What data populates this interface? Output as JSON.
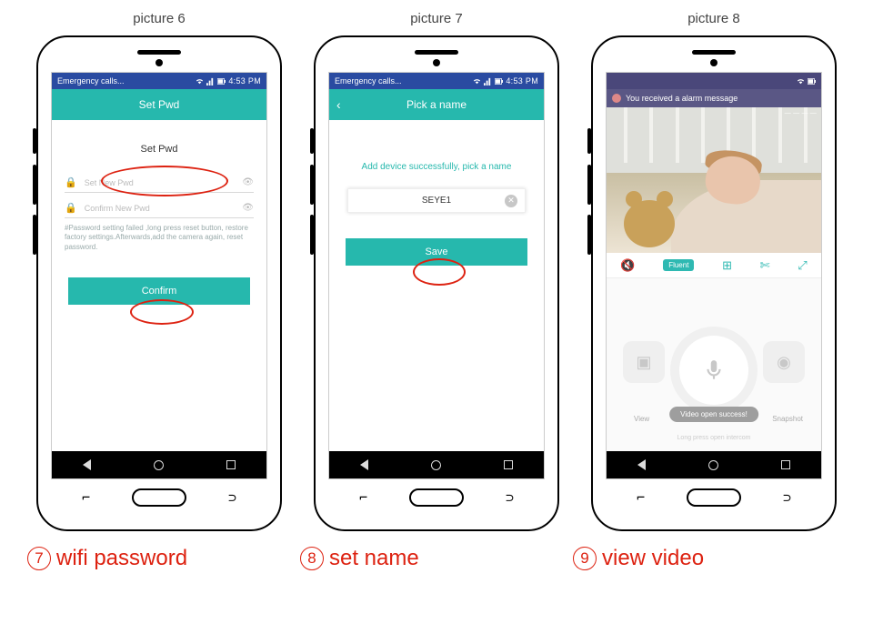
{
  "labels": {
    "pic6": "picture 6",
    "pic7": "picture 7",
    "pic8": "picture 8"
  },
  "status": {
    "left": "Emergency calls...",
    "right": "4:53 PM",
    "wifi_icon": "wifi-icon",
    "signal_icon": "signal-icon",
    "battery_icon": "battery-icon"
  },
  "screen6": {
    "appbar_title": "Set Pwd",
    "inner_title": "Set Pwd",
    "input1_placeholder": "Set New Pwd",
    "input2_placeholder": "Confirm New Pwd",
    "note": "#Password setting failed ,long press reset button, restore factory settings.Afterwards,add the camera again, reset password.",
    "confirm_btn": "Confirm"
  },
  "screen7": {
    "appbar_title": "Pick a name",
    "success": "Add device successfully, pick a name",
    "name_value": "SEYE1",
    "save_btn": "Save"
  },
  "screen8": {
    "alarm_text": "You received a alarm message",
    "quality_badge": "Fluent",
    "view_label": "View",
    "snapshot_label": "Snapshot",
    "toast": "Video open success!",
    "talk_hint": "Long press open intercom"
  },
  "captions": {
    "c7": {
      "num": "7",
      "text": "wifi password"
    },
    "c8": {
      "num": "8",
      "text": "set name"
    },
    "c9": {
      "num": "9",
      "text": "view video"
    }
  }
}
